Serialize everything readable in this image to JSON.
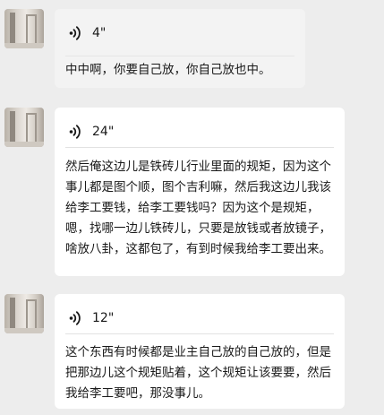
{
  "messages": [
    {
      "type": "voice",
      "duration": "4\"",
      "transcript": "中中啊，你要自己放，你自己放也中。"
    },
    {
      "type": "voice",
      "duration": "24\"",
      "transcript": "然后俺这边儿是铁砖儿行业里面的规矩，因为这个事儿都是图个顺，图个吉利嘛，然后我这边儿我该给李工要钱，给李工要钱吗？因为这个是规矩，嗯，找哪一边儿铁砖儿，只要是放钱或者放镜子，啥放八卦，这都包了，有到时候我给李工要出来。"
    },
    {
      "type": "voice",
      "duration": "12\"",
      "transcript": "这个东西有时候都是业主自己放的自己放的，但是把那边儿这个规矩贴着，这个规矩让该要要，然后我给李工要吧，那没事儿。"
    }
  ],
  "icons": {
    "voice": "voice-wave-icon",
    "avatar": "user-avatar"
  },
  "colors": {
    "background": "#ededed",
    "bubble": "#ffffff",
    "bubble_first": "#f3f3f3",
    "text": "#191919"
  }
}
